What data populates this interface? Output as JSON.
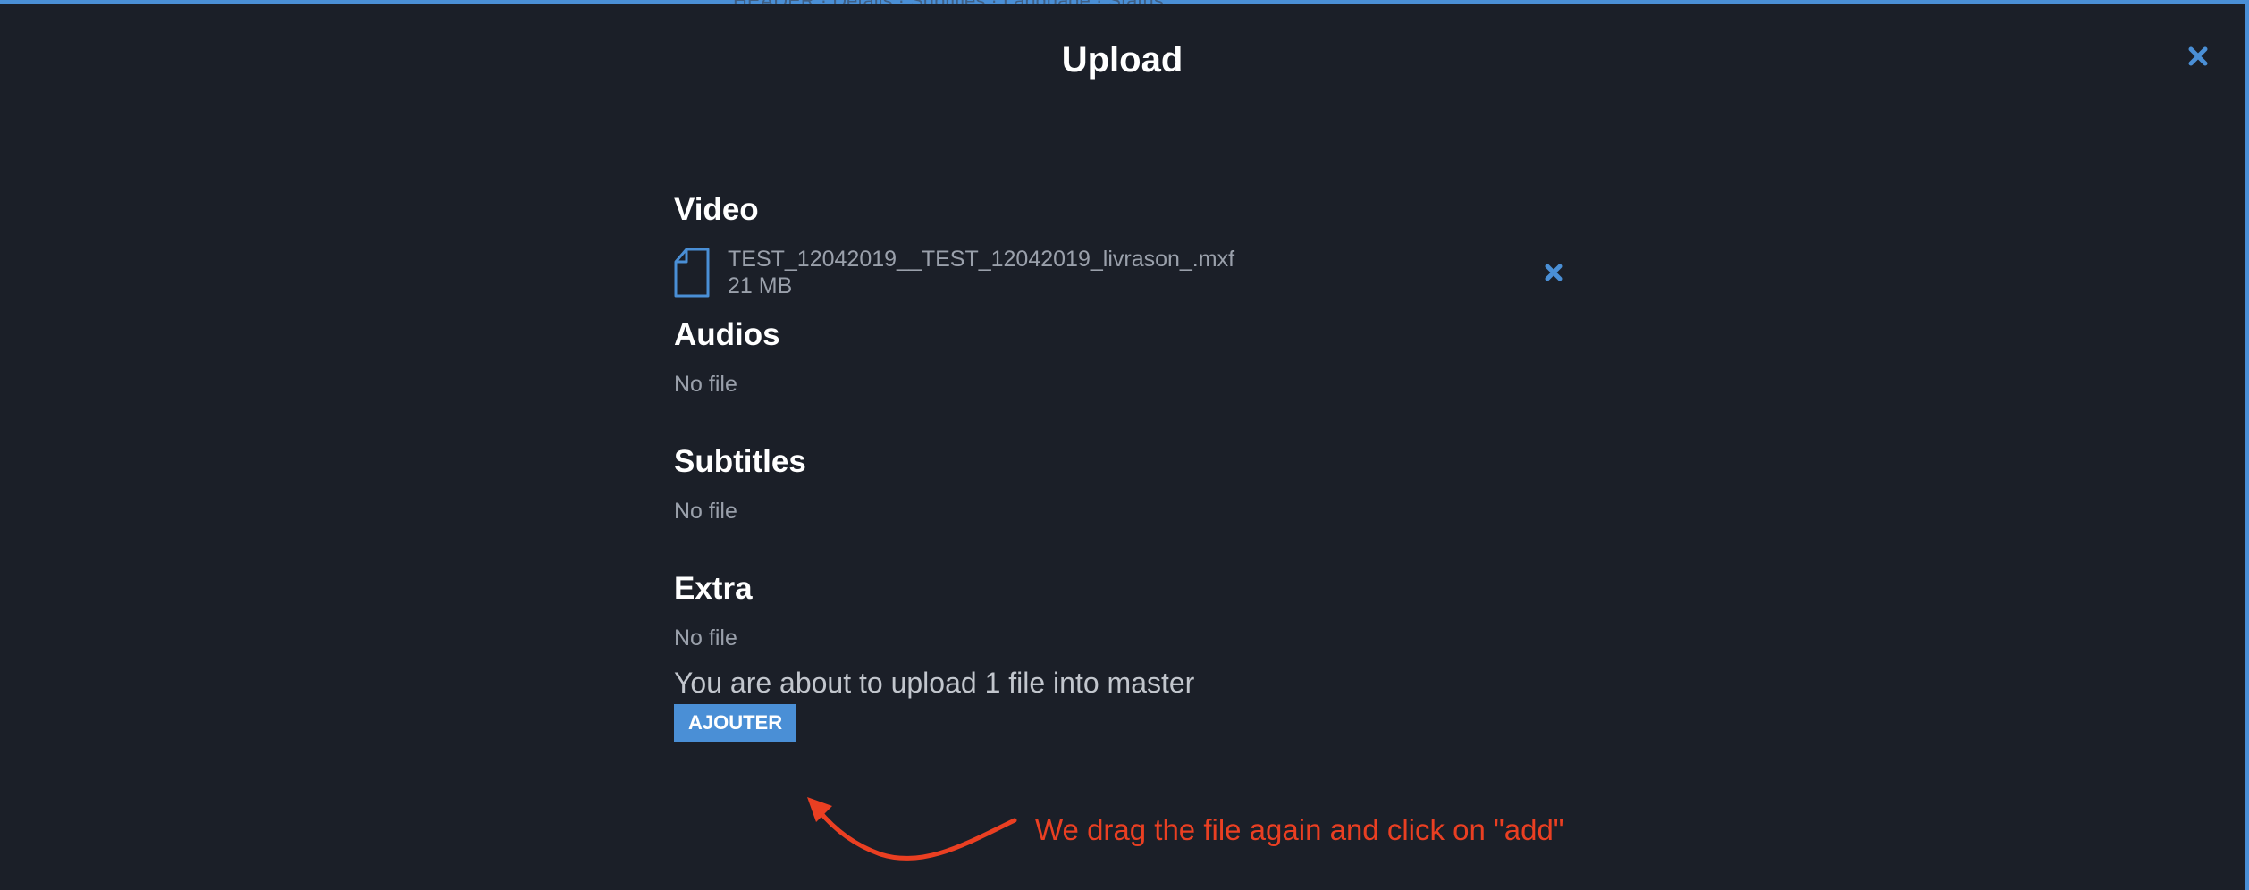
{
  "background_text": "HEADER · Details · Subtitles · Language · Status",
  "modal": {
    "title": "Upload",
    "close_icon": "close-icon"
  },
  "sections": {
    "video": {
      "title": "Video",
      "file": {
        "name": "TEST_12042019__TEST_12042019_livrason_.mxf",
        "size": "21 MB",
        "icon": "file-icon",
        "remove_icon": "close-icon"
      }
    },
    "audios": {
      "title": "Audios",
      "empty_text": "No file"
    },
    "subtitles": {
      "title": "Subtitles",
      "empty_text": "No file"
    },
    "extra": {
      "title": "Extra",
      "empty_text": "No file"
    }
  },
  "summary_text": "You are about to upload 1 file into master",
  "add_button_label": "AJOUTER",
  "annotation": {
    "text": "We drag the file again and click on \"add\"",
    "color": "#ea3f22"
  },
  "colors": {
    "accent": "#4a8fd6",
    "background": "#1b1f28",
    "muted_text": "#9aa0ab"
  }
}
